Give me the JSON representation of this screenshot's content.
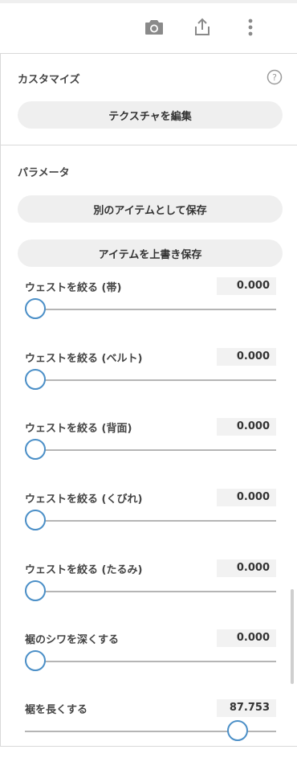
{
  "toolbar": {
    "camera_icon": "camera-icon",
    "share_icon": "share-icon",
    "more_icon": "more-vertical-icon"
  },
  "customize": {
    "title": "カスタマイズ",
    "help_icon": "help-circle-icon",
    "edit_texture_label": "テクスチャを編集"
  },
  "parameters": {
    "title": "パラメータ",
    "save_as_new_label": "別のアイテムとして保存",
    "overwrite_label": "アイテムを上書き保存"
  },
  "sliders": [
    {
      "label": "ウェストを絞る (帯)",
      "value": "0.000",
      "fraction": 0.0
    },
    {
      "label": "ウェストを絞る (ベルト)",
      "value": "0.000",
      "fraction": 0.0
    },
    {
      "label": "ウェストを絞る (背面)",
      "value": "0.000",
      "fraction": 0.0
    },
    {
      "label": "ウェストを絞る (くびれ)",
      "value": "0.000",
      "fraction": 0.0
    },
    {
      "label": "ウェストを絞る (たるみ)",
      "value": "0.000",
      "fraction": 0.0
    },
    {
      "label": "裾のシワを深くする",
      "value": "0.000",
      "fraction": 0.0
    },
    {
      "label": "裾を長くする",
      "value": "87.753",
      "fraction": 0.8775
    }
  ],
  "colors": {
    "accent": "#4b8fc7",
    "pill_bg": "#efefef",
    "track": "#b5b5b5"
  }
}
